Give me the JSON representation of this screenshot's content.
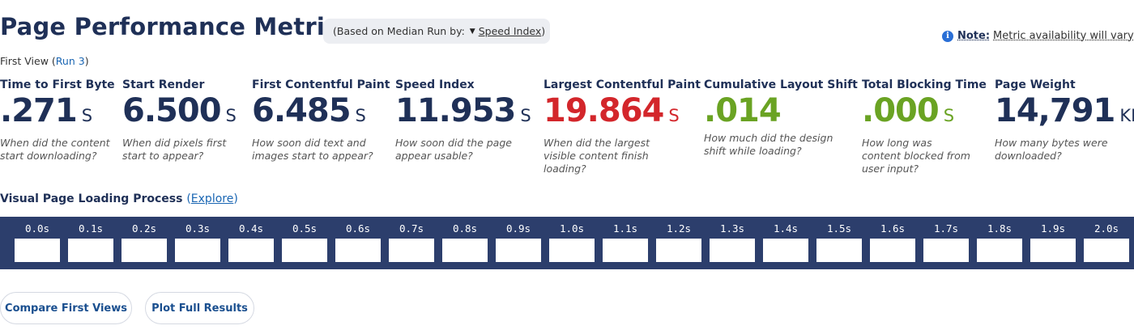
{
  "header": {
    "title": "Page Performance Metrics",
    "median_prefix": "(Based on Median Run by:",
    "median_value": "Speed Index",
    "median_suffix": ")",
    "note_label": "Note:",
    "note_text": "Metric availability will vary"
  },
  "run_info": {
    "prefix": "First View (",
    "run_link": "Run 3",
    "suffix": ")"
  },
  "metrics": [
    {
      "label": "Time to First Byte",
      "value": ".271",
      "unit": "S",
      "desc": "When did the content start downloading?",
      "color": "#1f3057"
    },
    {
      "label": "Start Render",
      "value": "6.500",
      "unit": "S",
      "desc": "When did pixels first start to appear?",
      "color": "#1f3057"
    },
    {
      "label": "First Contentful Paint",
      "value": "6.485",
      "unit": "S",
      "desc": "How soon did text and images start to appear?",
      "color": "#1f3057"
    },
    {
      "label": "Speed Index",
      "value": "11.953",
      "unit": "S",
      "desc": "How soon did the page appear usable?",
      "color": "#1f3057"
    },
    {
      "label": "Largest Contentful Paint",
      "value": "19.864",
      "unit": "S",
      "desc": "When did the largest visible content finish loading?",
      "color": "#d3262b"
    },
    {
      "label": "Cumulative Layout Shift",
      "value": ".014",
      "unit": "",
      "desc": "How much did the design shift while loading?",
      "color": "#6aa323"
    },
    {
      "label": "Total Blocking Time",
      "value": ".000",
      "unit": "S",
      "desc": "How long was content blocked from user input?",
      "color": "#6aa323"
    },
    {
      "label": "Page Weight",
      "value": "14,791",
      "unit": "KB",
      "desc": "How many bytes were downloaded?",
      "color": "#1f3057"
    }
  ],
  "visual": {
    "title": "Visual Page Loading Process",
    "explore_open": "(",
    "explore_link": "Explore",
    "explore_close": ")",
    "frames": [
      "0.0s",
      "0.1s",
      "0.2s",
      "0.3s",
      "0.4s",
      "0.5s",
      "0.6s",
      "0.7s",
      "0.8s",
      "0.9s",
      "1.0s",
      "1.1s",
      "1.2s",
      "1.3s",
      "1.4s",
      "1.5s",
      "1.6s",
      "1.7s",
      "1.8s",
      "1.9s",
      "2.0s"
    ]
  },
  "buttons": {
    "compare": "Compare First Views",
    "plot": "Plot Full Results"
  },
  "colors": {
    "navy": "#1f3057",
    "red": "#d3262b",
    "green": "#6aa323",
    "strip": "#2c3e6c",
    "link": "#1a66b3"
  }
}
